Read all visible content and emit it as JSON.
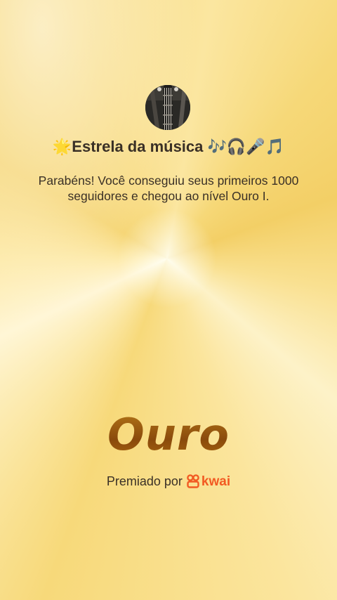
{
  "badge": {
    "title_prefix_emoji": "🌟",
    "title": "Estrela da música",
    "title_suffix_emoji": "🎶🎧🎤🎵",
    "message": "Parabéns! Você conseguiu seus primeiros 1000 seguidores e chegou ao nível Ouro I.",
    "level_name": "Ouro",
    "award_text": "Premiado por",
    "brand_name": "kwai"
  },
  "colors": {
    "gold_text": "#9a5a10",
    "brand": "#f25a22",
    "body_text": "#3a3026"
  },
  "icons": {
    "avatar": "guitar-photo-avatar",
    "brand_logo": "kwai-logo-icon"
  }
}
